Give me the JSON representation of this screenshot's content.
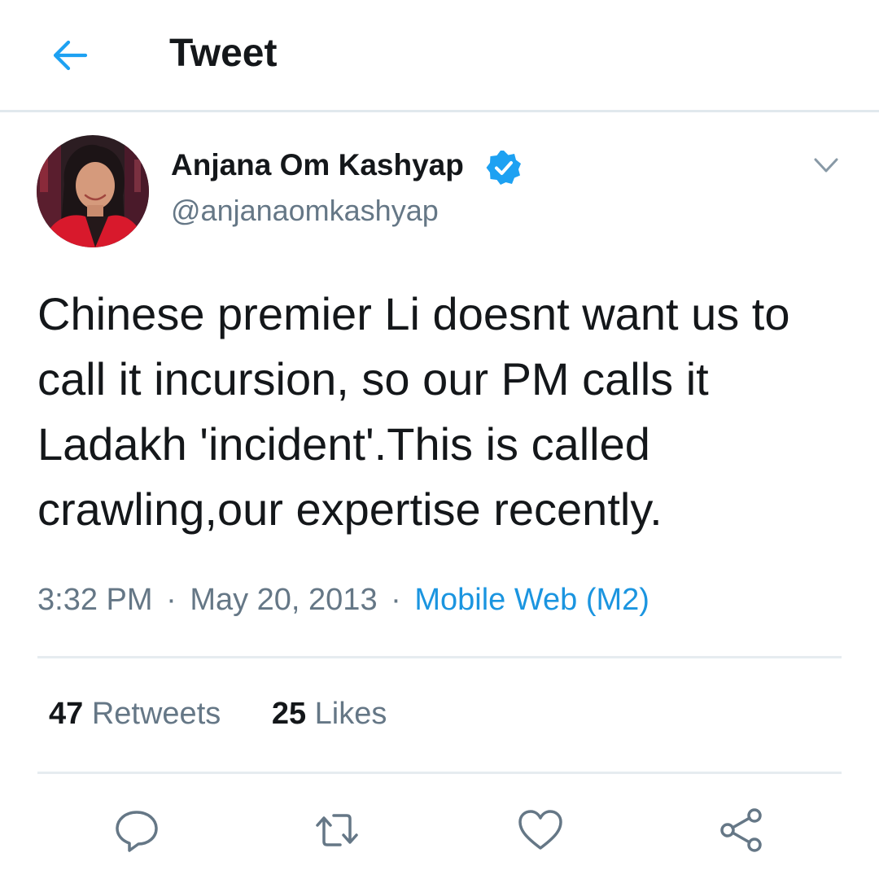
{
  "header": {
    "title": "Tweet",
    "back_icon": "arrow-left-icon",
    "accent_color": "#1da1f2"
  },
  "tweet": {
    "author": {
      "name": "Anjana Om Kashyap",
      "handle": "@anjanaomkashyap",
      "verified": true,
      "verified_icon": "verified-badge-icon"
    },
    "text": "Chinese premier Li doesnt want us to call it incursion, so our PM calls it Ladakh 'incident'.This is called crawling,our expertise recently.",
    "time": "3:32 PM",
    "date": "May 20, 2013",
    "separator": "·",
    "source": "Mobile Web (M2)",
    "source_color": "#1b95e0",
    "stats": {
      "retweets_count": "47",
      "retweets_label": "Retweets",
      "likes_count": "25",
      "likes_label": "Likes"
    },
    "actions": [
      {
        "icon": "reply-icon"
      },
      {
        "icon": "retweet-icon"
      },
      {
        "icon": "like-icon"
      },
      {
        "icon": "share-icon"
      }
    ],
    "menu_icon": "chevron-down-icon"
  }
}
